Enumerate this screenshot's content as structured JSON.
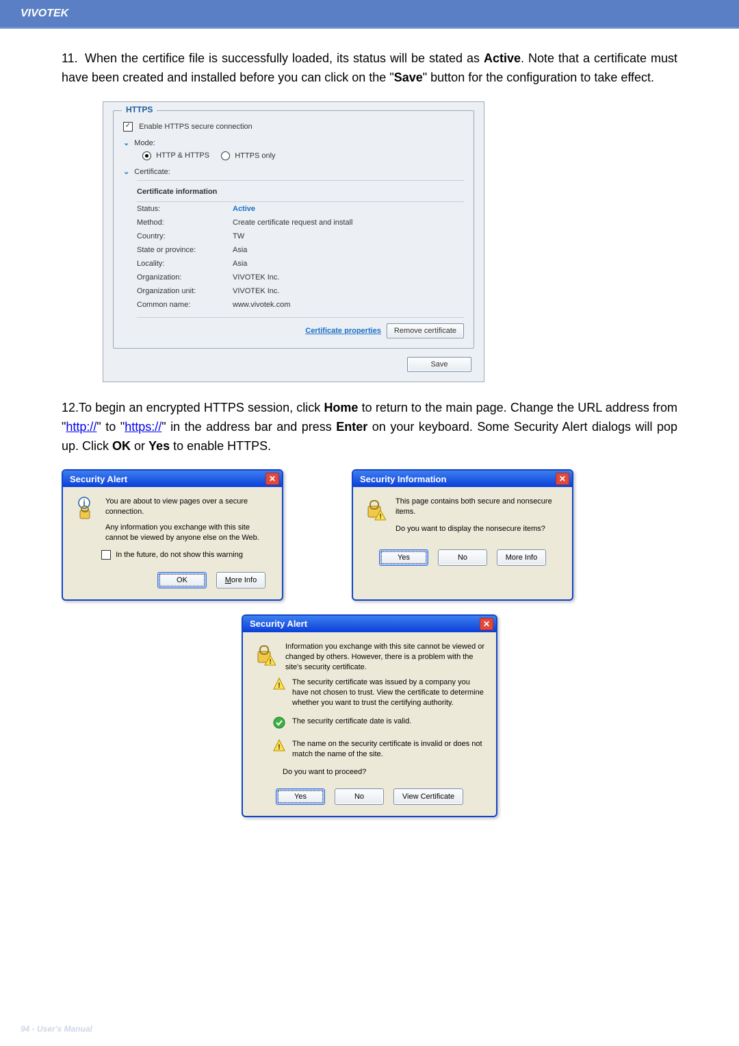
{
  "brand": "VIVOTEK",
  "step11": {
    "num": "11.",
    "text_a": "When the certifice file is successfully loaded, its status will be stated as ",
    "active": "Active",
    "text_b": ". Note that a certificate must have been created and installed before you can click on the \"",
    "save": "Save",
    "text_c": "\" button for the configuration to take effect."
  },
  "https_panel": {
    "legend": "HTTPS",
    "enable_label": "Enable HTTPS secure connection",
    "mode_label": "Mode:",
    "mode_opt1": "HTTP & HTTPS",
    "mode_opt2": "HTTPS only",
    "cert_label": "Certificate:",
    "cert_info_header": "Certificate information",
    "rows": [
      {
        "label": "Status:",
        "value": "Active"
      },
      {
        "label": "Method:",
        "value": "Create certificate request and install"
      },
      {
        "label": "Country:",
        "value": "TW"
      },
      {
        "label": "State or province:",
        "value": "Asia"
      },
      {
        "label": "Locality:",
        "value": "Asia"
      },
      {
        "label": "Organization:",
        "value": "VIVOTEK Inc."
      },
      {
        "label": "Organization unit:",
        "value": "VIVOTEK Inc."
      },
      {
        "label": "Common name:",
        "value": "www.vivotek.com"
      }
    ],
    "cert_props": "Certificate properties",
    "remove_btn": "Remove certificate",
    "save_btn": "Save"
  },
  "step12": {
    "num": "12.",
    "text_a": "To begin an encrypted HTTPS session, click ",
    "home": "Home",
    "text_b": " to return to the main page. Change the URL address from \"",
    "http": "http://",
    "text_c": "\" to \"",
    "https": "https://",
    "text_d": "\" in the address bar and press ",
    "enter": "Enter",
    "text_e": " on your keyboard. Some Security Alert dialogs will pop up. Click ",
    "ok": "OK",
    "text_f": " or ",
    "yes": "Yes",
    "text_g": " to enable HTTPS."
  },
  "dlg1": {
    "title": "Security Alert",
    "line1": "You are about to view pages over a secure connection.",
    "line2": "Any information you exchange with this site cannot be viewed by anyone else on the Web.",
    "chk": "In the future, do not show this warning",
    "ok": "OK",
    "more": "More Info"
  },
  "dlg2": {
    "title": "Security Information",
    "line1": "This page contains both secure and nonsecure items.",
    "line2": "Do you want to display the nonsecure items?",
    "yes": "Yes",
    "no": "No",
    "more": "More Info"
  },
  "dlg3": {
    "title": "Security Alert",
    "intro": "Information you exchange with this site cannot be viewed or changed by others. However, there is a problem with the site's security certificate.",
    "warn1": "The security certificate was issued by a company you have not chosen to trust. View the certificate to determine whether you want to trust the certifying authority.",
    "ok1": "The security certificate date is valid.",
    "warn2": "The name on the security certificate is invalid or does not match the name of the site.",
    "proceed": "Do you want to proceed?",
    "yes": "Yes",
    "no": "No",
    "view": "View Certificate"
  },
  "footer": "94 - User's Manual"
}
